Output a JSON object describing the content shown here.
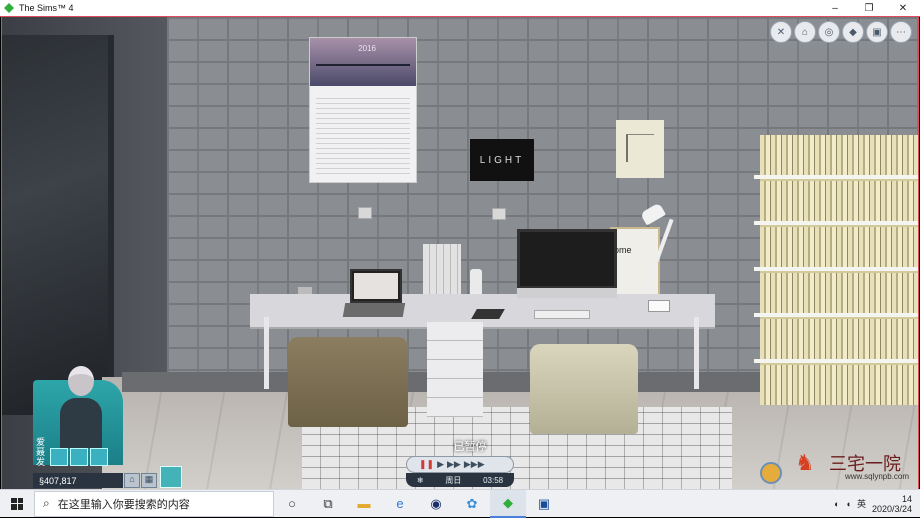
{
  "window": {
    "title": "The Sims™ 4",
    "controls": {
      "minimize": "–",
      "maximize": "❐",
      "close": "✕"
    }
  },
  "scene": {
    "calendar_year": "2016",
    "light_sign": "LIGHT",
    "frame_text": "ome"
  },
  "hud": {
    "top_buttons": [
      "tools-icon",
      "build-icon",
      "camera-icon",
      "triangle-icon",
      "gallery-icon",
      "more-icon"
    ],
    "sim_name": "爱聂发",
    "funds": "§407,817",
    "status": "已暂停",
    "speed_controls": {
      "pause": "❚❚",
      "play": "▶",
      "fast": "▶▶",
      "ultra": "▶▶▶"
    },
    "time": "03:58",
    "day_label": "周日"
  },
  "watermark": {
    "text": "三宅一院",
    "url": "www.sqlynpb.com"
  },
  "taskbar": {
    "search_placeholder": "在这里输入你要搜索的内容",
    "ime": "英",
    "time": "14",
    "date": "2020/3/24"
  },
  "colors": {
    "titlebar_border": "#e04a5a",
    "hud_teal": "#2da6a9",
    "taskbar": "#eef0f3"
  }
}
